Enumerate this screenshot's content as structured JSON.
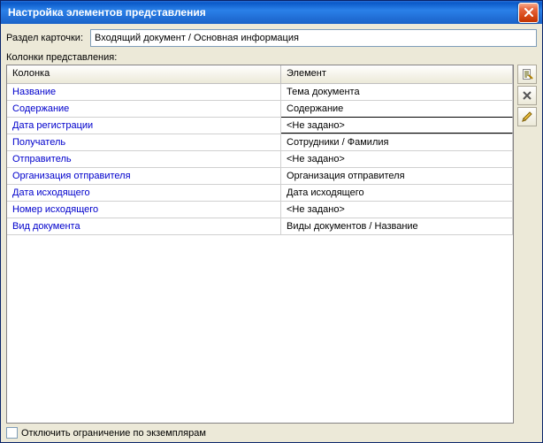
{
  "window": {
    "title": "Настройка элементов представления"
  },
  "section": {
    "label": "Раздел карточки:",
    "value": "Входящий документ / Основная информация"
  },
  "columns_label": "Колонки представления:",
  "table": {
    "headers": {
      "col1": "Колонка",
      "col2": "Элемент"
    },
    "rows": [
      {
        "col1": "Название",
        "col2": "Тема документа",
        "selected": false
      },
      {
        "col1": "Содержание",
        "col2": "Содержание",
        "selected": false
      },
      {
        "col1": "Дата регистрации",
        "col2": "<Не задано>",
        "selected": true
      },
      {
        "col1": "Получатель",
        "col2": "Сотрудники / Фамилия",
        "selected": false
      },
      {
        "col1": "Отправитель",
        "col2": "<Не задано>",
        "selected": false
      },
      {
        "col1": "Организация отправителя",
        "col2": "Организация отправителя",
        "selected": false
      },
      {
        "col1": "Дата исходящего",
        "col2": "Дата исходящего",
        "selected": false
      },
      {
        "col1": "Номер исходящего",
        "col2": "<Не задано>",
        "selected": false
      },
      {
        "col1": "Вид документа",
        "col2": "Виды документов / Название",
        "selected": false
      }
    ]
  },
  "footer": {
    "checkbox_label": "Отключить ограничение по экземплярам",
    "checked": false
  }
}
